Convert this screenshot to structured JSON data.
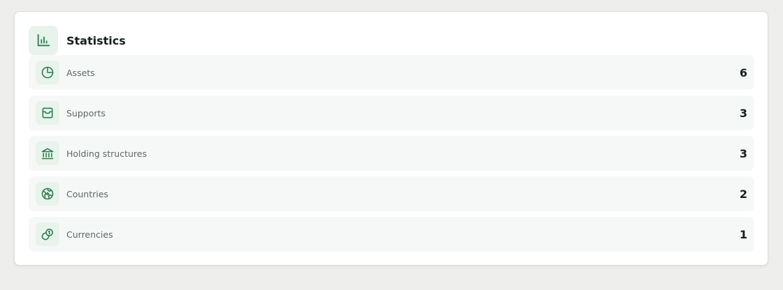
{
  "header": {
    "title": "Statistics",
    "icon": "bar-chart-icon"
  },
  "accent_color": "#2e7d4f",
  "icon_bg_color": "#e8f3ec",
  "rows": [
    {
      "label": "Assets",
      "value": "6",
      "icon": "pie-chart-icon"
    },
    {
      "label": "Supports",
      "value": "3",
      "icon": "archive-box-icon"
    },
    {
      "label": "Holding structures",
      "value": "3",
      "icon": "bank-icon"
    },
    {
      "label": "Countries",
      "value": "2",
      "icon": "globe-icon"
    },
    {
      "label": "Currencies",
      "value": "1",
      "icon": "coins-icon"
    }
  ]
}
